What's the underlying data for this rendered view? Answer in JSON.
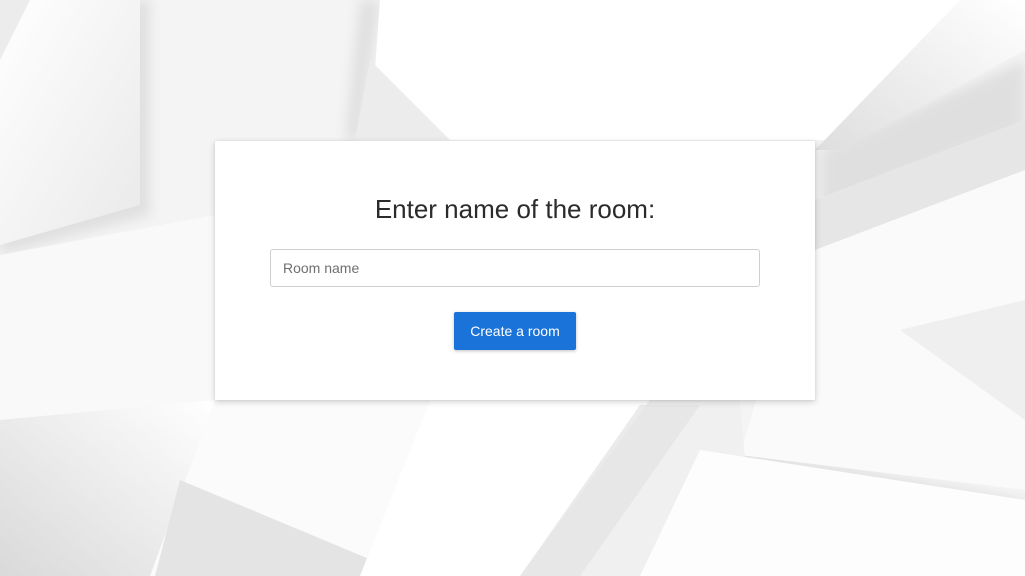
{
  "colors": {
    "background": "#f6f6f6",
    "card": "#ffffff",
    "button": "#1a73d9",
    "button_text": "#ffffff",
    "title_text": "#2b2b2b"
  },
  "dialog": {
    "title": "Enter name of the room:",
    "room_input": {
      "value": "",
      "placeholder": "Room name"
    },
    "create_button_label": "Create a room"
  }
}
